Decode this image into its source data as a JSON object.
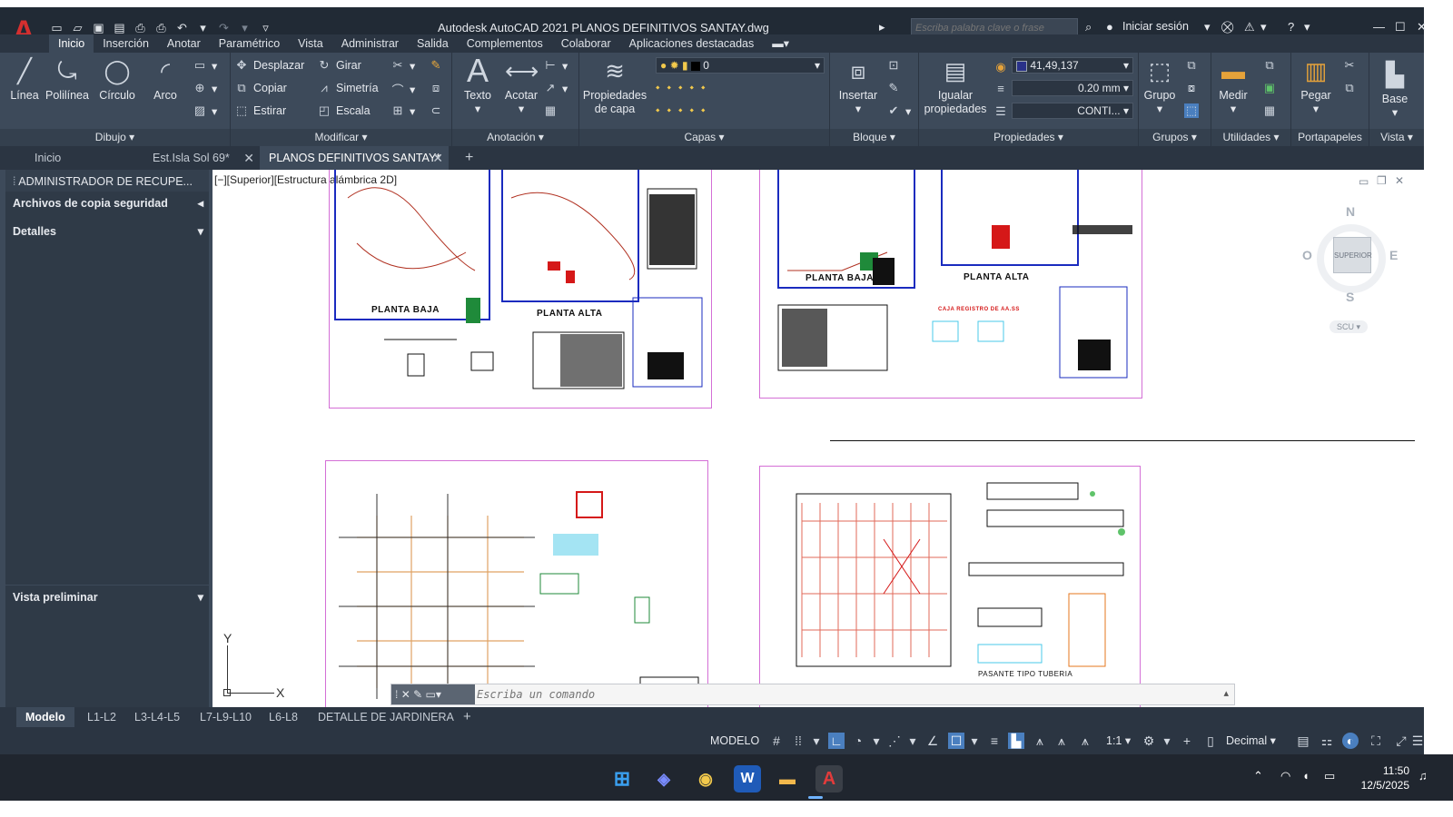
{
  "app": {
    "logo": "A",
    "title": "Autodesk AutoCAD 2021   PLANOS DEFINITIVOS SANTAY.dwg",
    "search_placeholder": "Escriba palabra clave o frase",
    "signin": "Iniciar sesión"
  },
  "ribbon_tabs": [
    "Inicio",
    "Inserción",
    "Anotar",
    "Paramétrico",
    "Vista",
    "Administrar",
    "Salida",
    "Complementos",
    "Colaborar",
    "Aplicaciones destacadas"
  ],
  "ribbon": {
    "dibujo": {
      "label": "Dibujo",
      "linea": "Línea",
      "polilinea": "Polilínea",
      "circulo": "Círculo",
      "arco": "Arco"
    },
    "modificar": {
      "label": "Modificar",
      "desplazar": "Desplazar",
      "girar": "Girar",
      "copiar": "Copiar",
      "simetria": "Simetría",
      "estirar": "Estirar",
      "escala": "Escala"
    },
    "anotacion": {
      "label": "Anotación",
      "texto": "Texto",
      "acotar": "Acotar"
    },
    "capas": {
      "label": "Capas",
      "propiedades": "Propiedades de capa",
      "current_layer": "0"
    },
    "bloque": {
      "label": "Bloque",
      "insertar": "Insertar"
    },
    "propiedades": {
      "label": "Propiedades",
      "igualar": "Igualar propiedades",
      "color_value": "41,49,137",
      "lineweight": "0.20 mm",
      "linetype": "CONTI..."
    },
    "grupos": {
      "label": "Grupos",
      "grupo": "Grupo"
    },
    "utilidades": {
      "label": "Utilidades",
      "medir": "Medir"
    },
    "portapapeles": {
      "label": "Portapapeles",
      "pegar": "Pegar"
    },
    "vista": {
      "label": "Vista",
      "base": "Base"
    }
  },
  "doc_tabs": [
    "Inicio",
    "Est.Isla Sol 69*",
    "PLANOS DEFINITIVOS SANTAY*"
  ],
  "palette": {
    "title": "ADMINISTRADOR DE RECUPE...",
    "backup": "Archivos de copia seguridad",
    "details": "Detalles",
    "preview": "Vista preliminar"
  },
  "viewport": {
    "label": "[−][Superior][Estructura alámbrica 2D]",
    "plans": {
      "planta_baja_1": "PLANTA BAJA",
      "planta_alta_1": "PLANTA ALTA",
      "planta_baja_2": "PLANTA BAJA",
      "planta_alta_2": "PLANTA ALTA",
      "caja_registro": "CAJA REGISTRO DE AA.SS",
      "pasante": "PASANTE TIPO TUBERIA"
    },
    "viewcube": {
      "n": "N",
      "s": "S",
      "e": "E",
      "o": "O",
      "face": "SUPERIOR",
      "ucs": "SCU"
    },
    "axis_y": "Y",
    "axis_x": "X"
  },
  "command_placeholder": "Escriba un comando",
  "layout_tabs": [
    "Modelo",
    "L1-L2",
    "L3-L4-L5",
    "L7-L9-L10",
    "L6-L8",
    "DETALLE DE JARDINERA"
  ],
  "status": {
    "mode": "MODELO",
    "scale": "1:1",
    "units": "Decimal"
  },
  "clock": {
    "time": "11:50",
    "date": "12/5/2025"
  },
  "colors": {
    "accent": "#4a7fbf",
    "sheet_border": "#d46fd6",
    "logo": "#d42f2f"
  }
}
